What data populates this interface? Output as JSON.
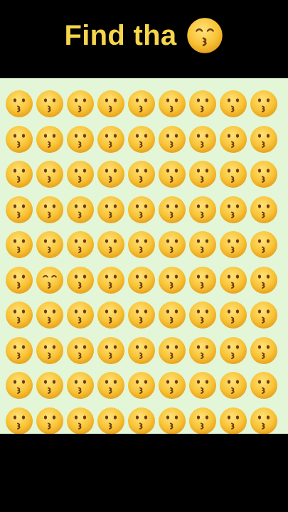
{
  "header": {
    "title": "Find tha",
    "title_emoji": "kissing-face-closed-eyes-icon"
  },
  "puzzle": {
    "rows": 10,
    "cols": 9,
    "base_emoji": "kissing-face-icon",
    "odd_emoji": "kissing-face-closed-eyes-icon",
    "odd_position": {
      "row": 6,
      "col": 2
    }
  },
  "colors": {
    "title": "#f6d54a",
    "board_background": "#e3f6d7",
    "emoji_face": "#f6c23a",
    "frame_background": "#000000"
  }
}
